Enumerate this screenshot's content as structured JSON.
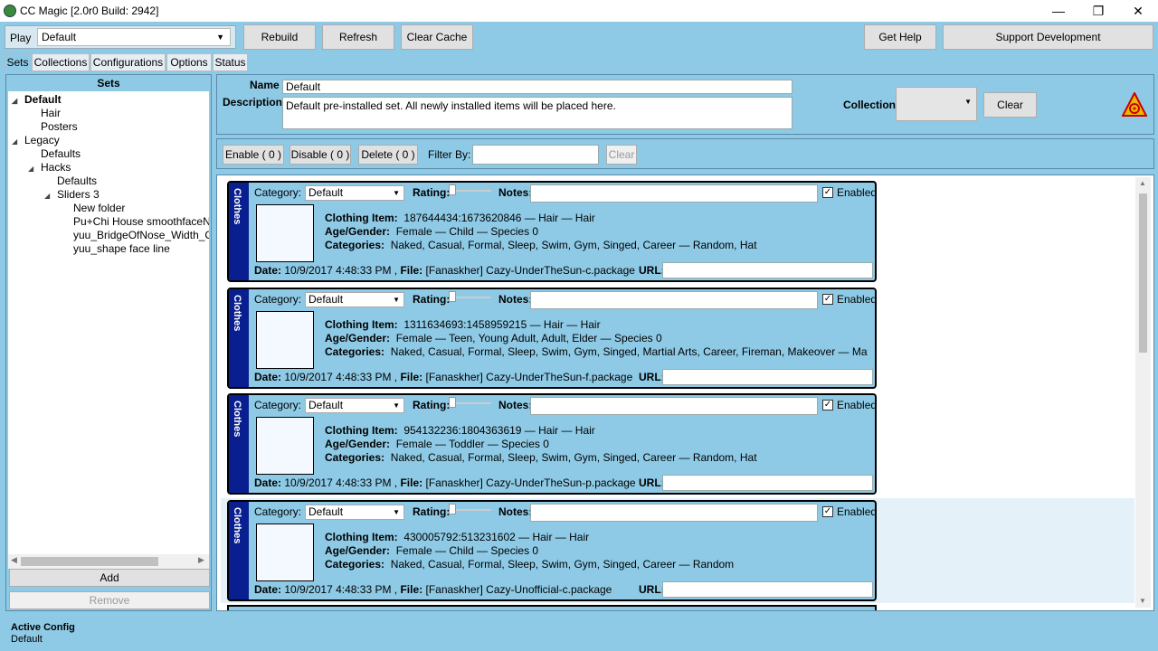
{
  "window": {
    "title": "CC Magic [2.0r0 Build: 2942]",
    "minimize": "—",
    "restore": "❐",
    "close": "✕"
  },
  "toolbar": {
    "play_label": "Play",
    "play_value": "Default",
    "rebuild": "Rebuild",
    "refresh": "Refresh",
    "clear_cache": "Clear Cache",
    "get_help": "Get Help",
    "support": "Support Development"
  },
  "tabs": [
    "Sets",
    "Collections",
    "Configurations",
    "Options",
    "Status"
  ],
  "sets": {
    "header": "Sets",
    "tree": [
      {
        "label": "Default",
        "level": 0,
        "expanded": true,
        "bold": true
      },
      {
        "label": "Hair",
        "level": 1
      },
      {
        "label": "Posters",
        "level": 1
      },
      {
        "label": "Legacy",
        "level": 0,
        "expanded": true
      },
      {
        "label": "Defaults",
        "level": 1
      },
      {
        "label": "Hacks",
        "level": 1,
        "expanded": true
      },
      {
        "label": "Defaults",
        "level": 2
      },
      {
        "label": "Sliders 3",
        "level": 2,
        "expanded": true
      },
      {
        "label": "New folder",
        "level": 3
      },
      {
        "label": "Pu+Chi House smoothfaceNoi",
        "level": 3
      },
      {
        "label": "yuu_BridgeOfNose_Width_Cor",
        "level": 3
      },
      {
        "label": "yuu_shape face line",
        "level": 3
      }
    ],
    "add": "Add",
    "remove": "Remove"
  },
  "details": {
    "name_label": "Name",
    "name_value": "Default",
    "description_label": "Description",
    "description_value": "Default pre-installed set.  All newly installed items will be placed here.",
    "collection_label": "Collection",
    "collection_value": "",
    "clear": "Clear"
  },
  "filter": {
    "enable": "Enable ( 0 )",
    "disable": "Disable ( 0 )",
    "delete": "Delete ( 0 )",
    "filter_label": "Filter By:",
    "filter_value": "",
    "clear": "Clear"
  },
  "item_labels": {
    "type": "Clothes",
    "category": "Category:",
    "rating": "Rating:",
    "notes": "Notes:",
    "enabled": "Enabled",
    "clothing_item": "Clothing Item:",
    "age_gender": "Age/Gender:",
    "categories": "Categories:",
    "date": "Date:",
    "file": "File:",
    "url": "URL:",
    "check": "✓"
  },
  "items": [
    {
      "category": "Default",
      "clothing_item": "187644434:1673620846  —  Hair  —  Hair",
      "age_gender": "Female — Child — Species 0",
      "categories": "Naked, Casual, Formal, Sleep, Swim, Gym, Singed, Career  —  Random, Hat",
      "date": "10/9/2017 4:48:33 PM ,",
      "file": "[Fanaskher] Cazy-UnderTheSun-c.package",
      "enabled": true
    },
    {
      "category": "Default",
      "clothing_item": "1311634693:1458959215  —  Hair  —  Hair",
      "age_gender": "Female — Teen, Young Adult, Adult, Elder — Species 0",
      "categories": "Naked, Casual, Formal, Sleep, Swim, Gym, Singed, Martial Arts, Career, Fireman, Makeover  —  Maternity, Ra",
      "date": "10/9/2017 4:48:33 PM ,",
      "file": "[Fanaskher] Cazy-UnderTheSun-f.package",
      "enabled": true
    },
    {
      "category": "Default",
      "clothing_item": "954132236:1804363619  —  Hair  —  Hair",
      "age_gender": "Female — Toddler — Species 0",
      "categories": "Naked, Casual, Formal, Sleep, Swim, Gym, Singed, Career  —  Random, Hat",
      "date": "10/9/2017 4:48:33 PM ,",
      "file": "[Fanaskher] Cazy-UnderTheSun-p.package",
      "enabled": true
    },
    {
      "category": "Default",
      "clothing_item": "430005792:513231602  —  Hair  —  Hair",
      "age_gender": "Female — Child — Species 0",
      "categories": "Naked, Casual, Formal, Sleep, Swim, Gym, Singed, Career  —  Random",
      "date": "10/9/2017 4:48:33 PM ,",
      "file": "[Fanaskher] Cazy-Unofficial-c.package",
      "enabled": true
    }
  ],
  "status": {
    "label": "Active Config",
    "value": "Default"
  },
  "colors": {
    "accent": "#8ecae6",
    "side_bar": "#0a1f8f",
    "warning": "#e8b800"
  }
}
